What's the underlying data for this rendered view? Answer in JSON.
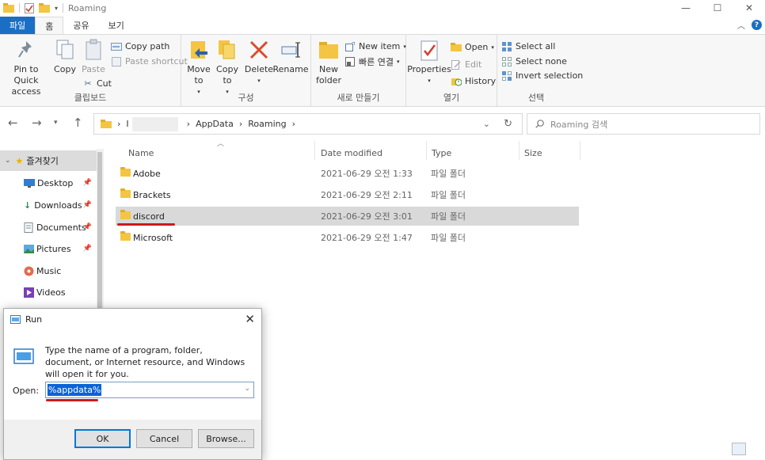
{
  "titlebar": {
    "title": "Roaming"
  },
  "tabs": {
    "file": "파일",
    "home": "홈",
    "share": "공유",
    "view": "보기"
  },
  "ribbon": {
    "clipboard": {
      "pin": "Pin to Quick access",
      "copy": "Copy",
      "paste": "Paste",
      "copy_path": "Copy path",
      "paste_shortcut": "Paste shortcut",
      "cut": "Cut",
      "label": "클립보드"
    },
    "organize": {
      "move_to": "Move to",
      "copy_to": "Copy to",
      "delete": "Delete",
      "rename": "Rename",
      "label": "구성"
    },
    "new": {
      "new_folder": "New folder",
      "new_item": "New item",
      "easy_access": "빠른 연결",
      "label": "새로 만들기"
    },
    "open": {
      "properties": "Properties",
      "open": "Open",
      "edit": "Edit",
      "history": "History",
      "label": "열기"
    },
    "select": {
      "select_all": "Select all",
      "select_none": "Select none",
      "invert": "Invert selection",
      "label": "선택"
    }
  },
  "address": {
    "root": "I",
    "seg1": "AppData",
    "seg2": "Roaming",
    "search_placeholder": "Roaming 검색"
  },
  "nav": {
    "quick_access": "즐겨찾기",
    "items": [
      {
        "label": "Desktop",
        "icon": "desktop-icon",
        "pinned": true
      },
      {
        "label": "Downloads",
        "icon": "downloads-icon",
        "pinned": true
      },
      {
        "label": "Documents",
        "icon": "documents-icon",
        "pinned": true
      },
      {
        "label": "Pictures",
        "icon": "pictures-icon",
        "pinned": true
      },
      {
        "label": "Music",
        "icon": "music-icon",
        "pinned": false
      },
      {
        "label": "Videos",
        "icon": "videos-icon",
        "pinned": false
      }
    ]
  },
  "columns": {
    "name": "Name",
    "date": "Date modified",
    "type": "Type",
    "size": "Size"
  },
  "files": [
    {
      "name": "Adobe",
      "date": "2021-06-29 오전 1:33",
      "type": "파일 폴더",
      "selected": false
    },
    {
      "name": "Brackets",
      "date": "2021-06-29 오전 2:11",
      "type": "파일 폴더",
      "selected": false
    },
    {
      "name": "discord",
      "date": "2021-06-29 오전 3:01",
      "type": "파일 폴더",
      "selected": true
    },
    {
      "name": "Microsoft",
      "date": "2021-06-29 오전 1:47",
      "type": "파일 폴더",
      "selected": false
    }
  ],
  "run": {
    "title": "Run",
    "message": "Type the name of a program, folder, document, or Internet resource, and Windows will open it for you.",
    "open_label": "Open:",
    "value": "%appdata%",
    "ok": "OK",
    "cancel": "Cancel",
    "browse": "Browse..."
  },
  "colors": {
    "accent": "#1a6fc5",
    "highlight": "#cc1a1a",
    "selection": "#d9d9d9"
  }
}
